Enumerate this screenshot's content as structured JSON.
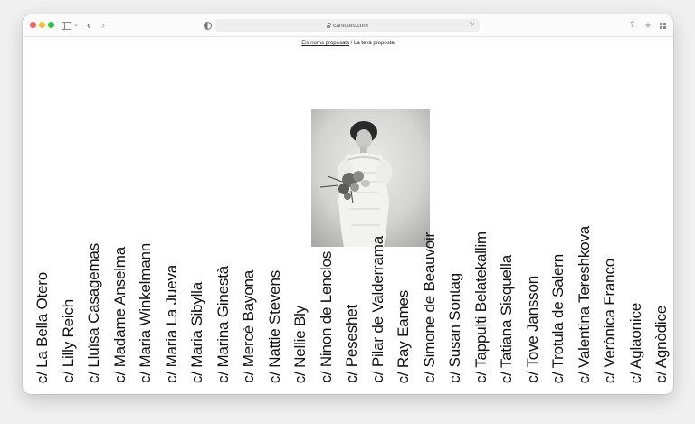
{
  "browser": {
    "url": "cantotes.com"
  },
  "breadcrumb": {
    "link": "Els noms proposats",
    "separator": " / ",
    "current": "La teva proposta"
  },
  "names": [
    "c/ La Bella Otero",
    "c/ Lilly Reich",
    "c/ Lluïsa Casagemas",
    "c/ Madame Anselma",
    "c/ Maria Winkelmann",
    "c/ Maria La Jueva",
    "c/ Maria Sibylla",
    "c/ Marina Ginestà",
    "c/ Mercè Bayona",
    "c/ Nattie Stevens",
    "c/ Nellie Bly",
    "c/ Ninon de Lenclos",
    "c/ Peseshet",
    "c/ Pilar de Valderrama",
    "c/ Ray Eames",
    "c/ Simone de Beauvoir",
    "c/ Susan Sontag",
    "c/ Tappulti Belatekallim",
    "c/ Tatiana Sisquella",
    "c/ Tove Jansson",
    "c/ Trotula de Salern",
    "c/ Valentina Tereshkova",
    "c/ Verònica Franco",
    "c/ Aglaonice",
    "c/ Agnòdice"
  ],
  "colors": {
    "text": "#111111",
    "background": "#ffffff"
  }
}
